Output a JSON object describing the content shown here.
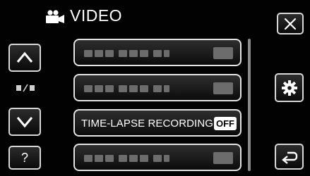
{
  "header": {
    "title": "VIDEO",
    "mode_icon": "video-camera-icon"
  },
  "nav": {
    "up_icon": "chevron-up-icon",
    "down_icon": "chevron-down-icon",
    "help_label": "?",
    "close_icon": "close-icon",
    "settings_icon": "gear-icon",
    "back_icon": "return-arrow-icon"
  },
  "menu": {
    "items": [
      {
        "label": "",
        "value": ""
      },
      {
        "label": "",
        "value": ""
      },
      {
        "label": "TIME-LAPSE RECORDING",
        "value": "OFF"
      },
      {
        "label": "",
        "value": ""
      }
    ]
  },
  "colors": {
    "background": "#020202",
    "button_border": "#d8d8d8",
    "text": "#ffffff"
  }
}
